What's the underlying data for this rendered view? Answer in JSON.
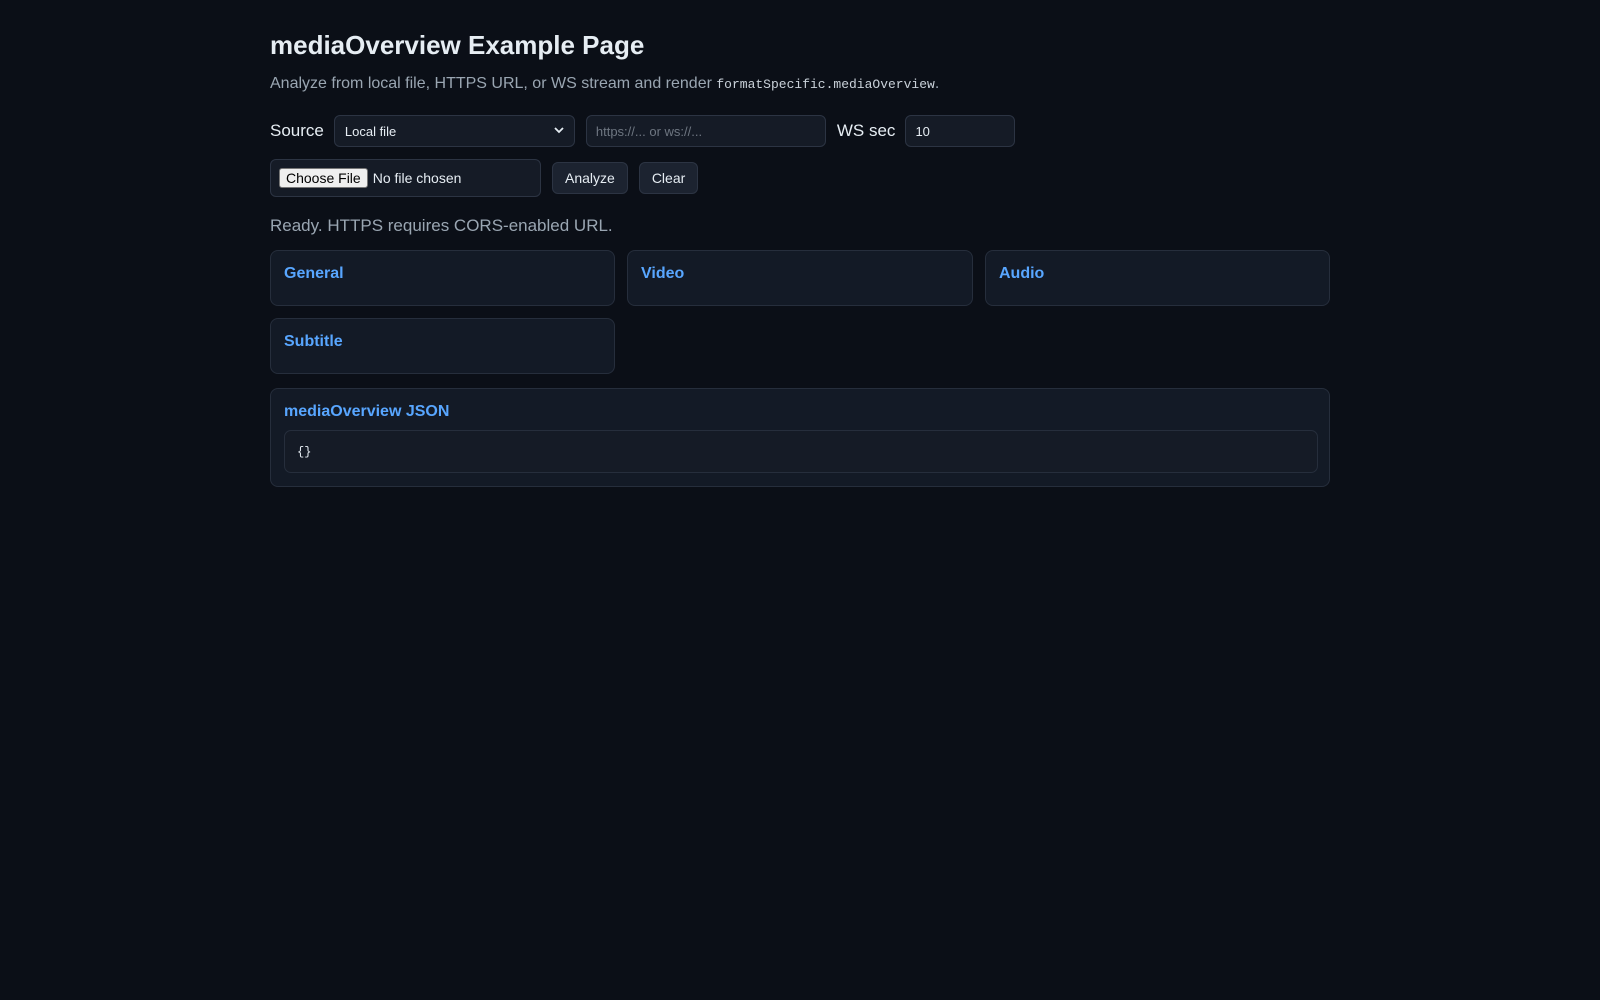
{
  "header": {
    "title": "mediaOverview Example Page",
    "subtitle_text": "Analyze from local file, HTTPS URL, or WS stream and render ",
    "subtitle_code": "formatSpecific.mediaOverview",
    "subtitle_end": "."
  },
  "controls": {
    "source_label": "Source",
    "source_selected": "Local file",
    "url_placeholder": "https://... or ws://...",
    "ws_sec_label": "WS sec",
    "ws_sec_value": "10",
    "choose_file_label": "Choose File",
    "file_status": "No file chosen",
    "analyze_label": "Analyze",
    "clear_label": "Clear"
  },
  "status": "Ready. HTTPS requires CORS-enabled URL.",
  "sections": {
    "general": "General",
    "video": "Video",
    "audio": "Audio",
    "subtitle": "Subtitle"
  },
  "json_panel": {
    "title": "mediaOverview JSON",
    "content": "{}"
  }
}
